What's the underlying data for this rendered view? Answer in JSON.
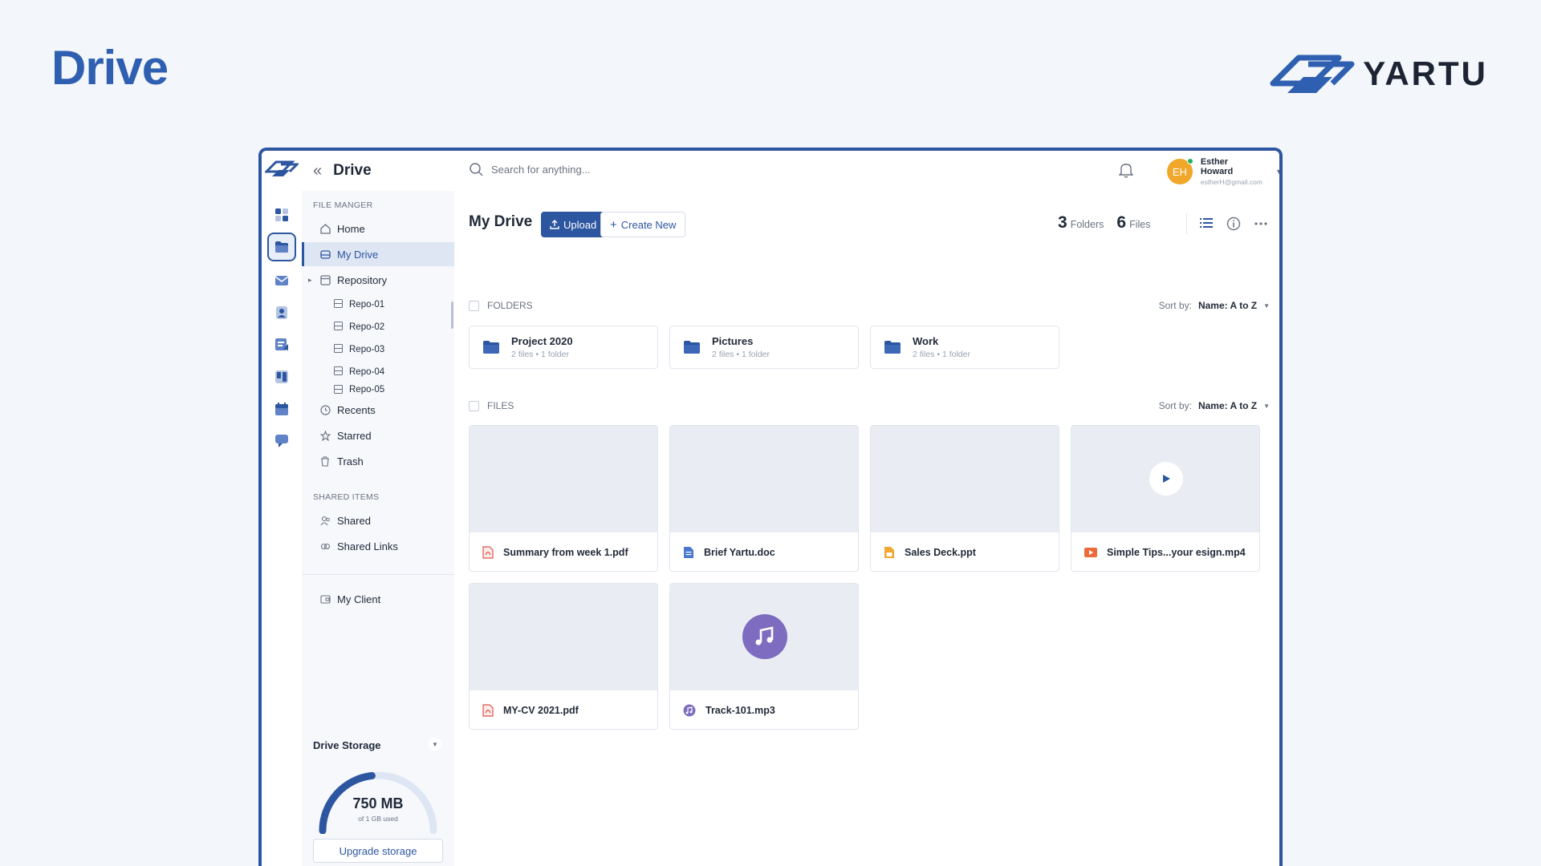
{
  "page": {
    "title": "Drive",
    "brand": "YARTU"
  },
  "sidebar": {
    "title": "Drive",
    "section_file": "FILE MANGER",
    "items": [
      {
        "label": "Home",
        "icon": "home-icon"
      },
      {
        "label": "My Drive",
        "icon": "drive-icon",
        "active": true
      },
      {
        "label": "Repository",
        "icon": "repository-icon"
      }
    ],
    "repos": [
      "Repo-01",
      "Repo-02",
      "Repo-03",
      "Repo-04",
      "Repo-05"
    ],
    "items2": [
      {
        "label": "Recents",
        "icon": "clock-icon"
      },
      {
        "label": "Starred",
        "icon": "star-icon"
      },
      {
        "label": "Trash",
        "icon": "trash-icon"
      }
    ],
    "section_shared": "SHARED ITEMS",
    "shared": [
      {
        "label": "Shared",
        "icon": "users-icon"
      },
      {
        "label": "Shared Links",
        "icon": "link-icon"
      }
    ],
    "client": {
      "label": "My Client",
      "icon": "client-icon"
    },
    "storage": {
      "title": "Drive Storage",
      "used": "750 MB",
      "sub": "of 1 GB used",
      "fraction": 0.75,
      "upgrade": "Upgrade storage"
    }
  },
  "topbar": {
    "search_placeholder": "Search for anything...",
    "user": {
      "initials": "EH",
      "name": "Esther Howard",
      "email": "estherH@gmail.com"
    }
  },
  "main": {
    "title": "My Drive",
    "upload": "Upload",
    "create": "Create New",
    "folders_count": "3",
    "folders_label": "Folders",
    "files_count": "6",
    "files_label": "Files",
    "folders_section": "FOLDERS",
    "files_section": "FILES",
    "sort_label": "Sort by:",
    "sort_value": "Name: A to Z",
    "folders": [
      {
        "name": "Project 2020",
        "meta": "2 files • 1 folder"
      },
      {
        "name": "Pictures",
        "meta": "2 files • 1 folder"
      },
      {
        "name": "Work",
        "meta": "2 files • 1 folder"
      }
    ],
    "files": [
      {
        "name": "Summary from week 1.pdf",
        "type": "pdf"
      },
      {
        "name": "Brief Yartu.doc",
        "type": "doc"
      },
      {
        "name": "Sales Deck.ppt",
        "type": "ppt"
      },
      {
        "name": "Simple Tips...your esign.mp4",
        "type": "video"
      },
      {
        "name": "MY-CV 2021.pdf",
        "type": "pdf"
      },
      {
        "name": "Track-101.mp3",
        "type": "audio"
      }
    ]
  },
  "colors": {
    "primary": "#2d56a0",
    "pdf": "#e0534a",
    "doc": "#4a78d0",
    "ppt": "#f0a733",
    "video": "#ec6a3c",
    "audio": "#7e6cc0"
  }
}
